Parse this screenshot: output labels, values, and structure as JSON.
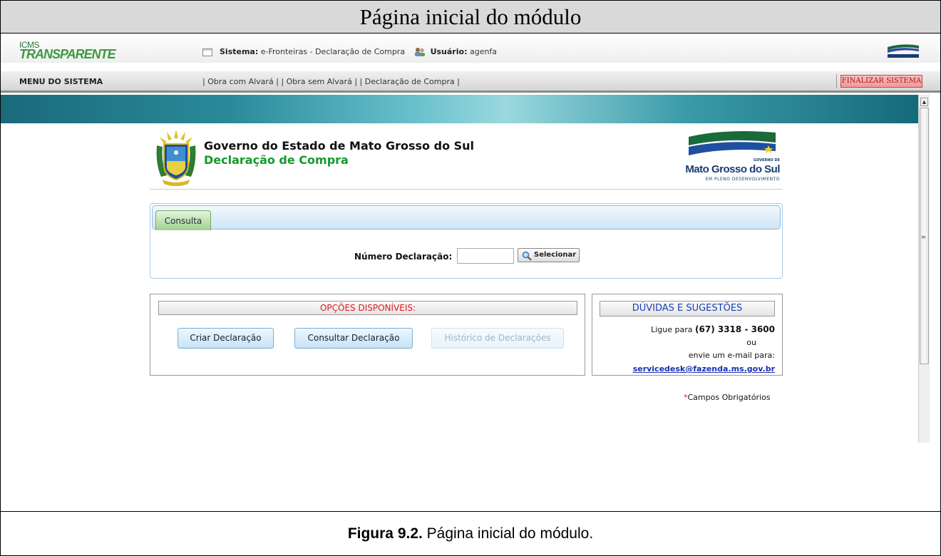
{
  "document": {
    "title": "Página inicial do módulo",
    "caption_bold": "Figura 9.2.",
    "caption_text": " Página inicial do módulo."
  },
  "header": {
    "logo_top": "ICMS",
    "logo_bottom": "TRANSPARENTE",
    "system_label": "Sistema:",
    "system_value": "e-Fronteiras - Declaração de Compra",
    "user_label": "Usuário:",
    "user_value": "agenfa"
  },
  "menu": {
    "label": "MENU DO SISTEMA",
    "links": [
      {
        "label": "Obra com Alvará"
      },
      {
        "label": "Obra sem Alvará"
      },
      {
        "label": "Declaração de Compra"
      }
    ],
    "finalize_label": "FINALIZAR SISTEMA"
  },
  "page": {
    "gov_title": "Governo do Estado de Mato Grosso do Sul",
    "gov_subtitle": "Declaração de Compra",
    "ms_logo_gov": "GOVERNO DE",
    "ms_logo_name": "Mato Grosso do Sul",
    "ms_logo_tag": "EM PLENO DESENVOLVIMENTO"
  },
  "consulta": {
    "tab_label": "Consulta",
    "field_label": "Número Declaração:",
    "field_value": "",
    "select_button": "Selecionar"
  },
  "opcoes": {
    "title": "OPÇÕES DISPONÍVEIS:",
    "buttons": [
      {
        "label": "Criar Declaração",
        "enabled": true
      },
      {
        "label": "Consultar Declaração",
        "enabled": true
      },
      {
        "label": "Histórico de Declarações",
        "enabled": false
      }
    ]
  },
  "duvidas": {
    "title": "DÚVIDAS E SUGESTÕES",
    "line1_prefix": "Ligue para ",
    "phone": "(67) 3318 - 3600",
    "line2": "ou",
    "line3": "envie um e-mail para:",
    "email": "servicedesk@fazenda.ms.gov.br"
  },
  "footer_note": {
    "star": "*",
    "text": "Campos Obrigatórios"
  },
  "colors": {
    "accent_green": "#139a2a",
    "alert_red": "#e01818",
    "link_blue": "#1a2fb0"
  }
}
